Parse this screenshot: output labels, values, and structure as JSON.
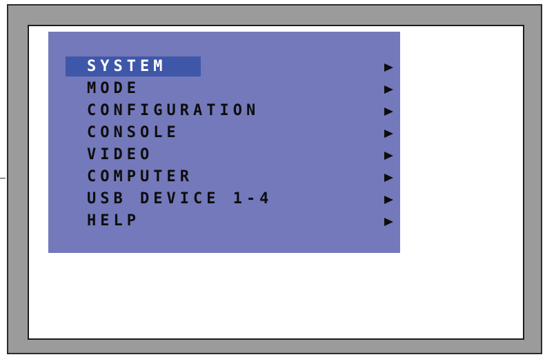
{
  "osd_menu": {
    "items": [
      {
        "label": "SYSTEM",
        "selected": true
      },
      {
        "label": "MODE",
        "selected": false
      },
      {
        "label": "CONFIGURATION",
        "selected": false
      },
      {
        "label": "CONSOLE",
        "selected": false
      },
      {
        "label": "VIDEO",
        "selected": false
      },
      {
        "label": "COMPUTER",
        "selected": false
      },
      {
        "label": "USB DEVICE 1-4",
        "selected": false
      },
      {
        "label": "HELP",
        "selected": false
      }
    ],
    "submenu_icon": "right-triangle-icon",
    "colors": {
      "panel_background": "#7479bb",
      "selection_background": "#3f57a8",
      "selected_text": "#ffffff",
      "text": "#0d0d0d"
    }
  }
}
